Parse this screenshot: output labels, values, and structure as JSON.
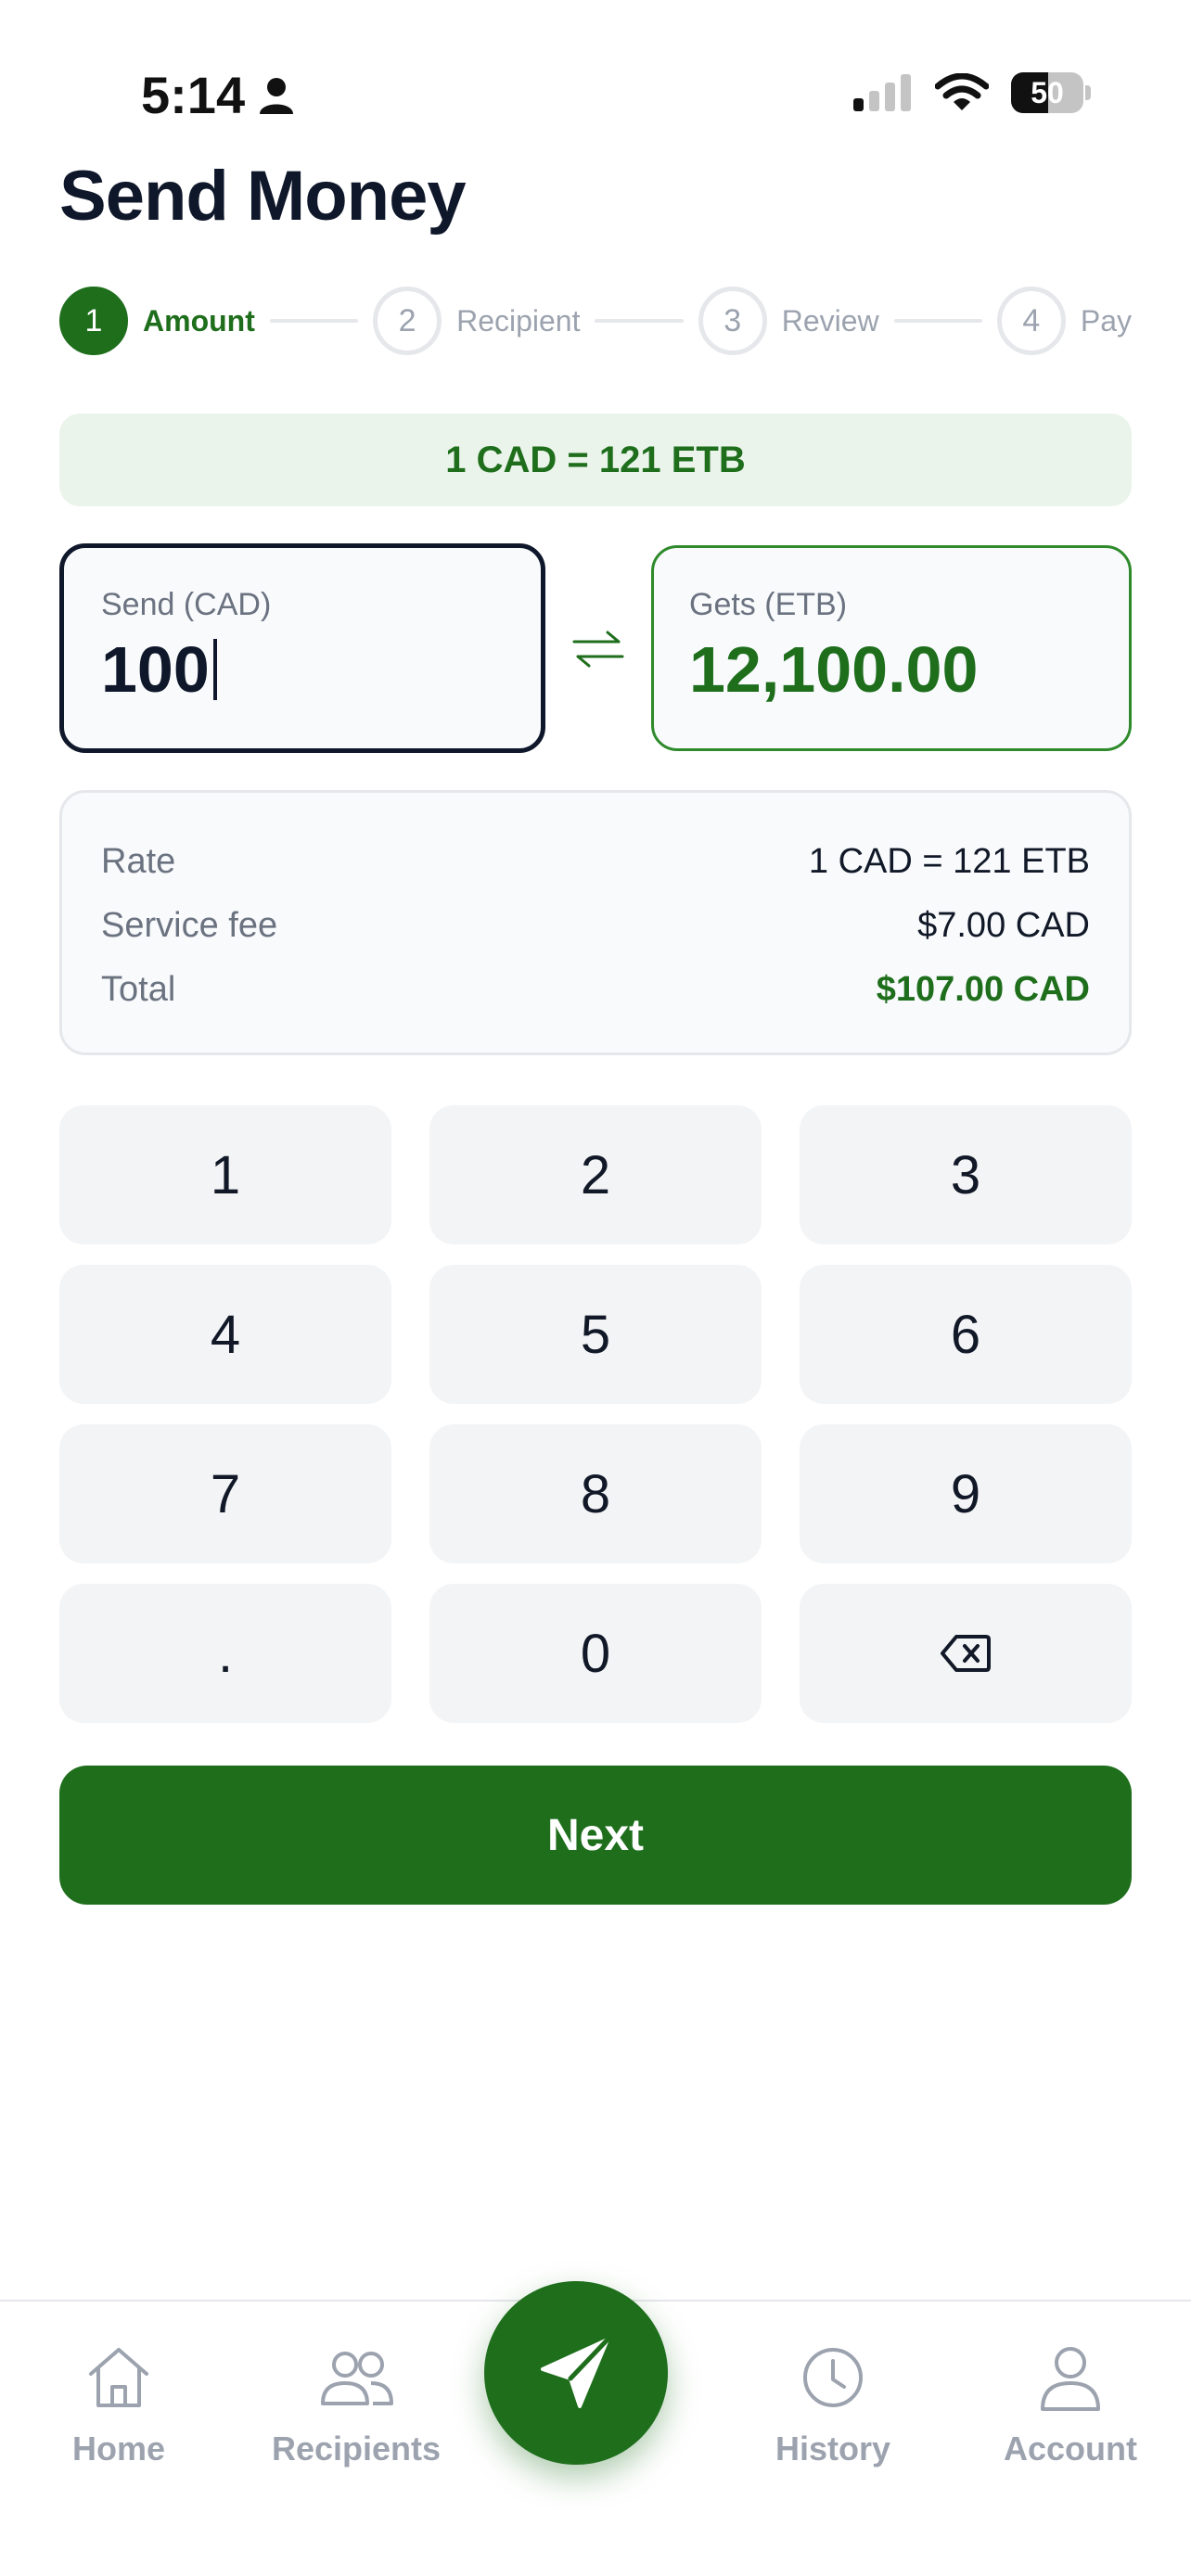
{
  "status": {
    "time": "5:14",
    "battery": "50"
  },
  "header": {
    "title": "Send Money"
  },
  "stepper": {
    "steps": [
      {
        "number": "1",
        "label": "Amount"
      },
      {
        "number": "2",
        "label": "Recipient"
      },
      {
        "number": "3",
        "label": "Review"
      },
      {
        "number": "4",
        "label": "Pay"
      }
    ],
    "active_index": 0
  },
  "rate_banner": {
    "text": "1 CAD = 121 ETB"
  },
  "send": {
    "label": "Send (CAD)",
    "value": "100"
  },
  "gets": {
    "label": "Gets (ETB)",
    "value": "12,100.00"
  },
  "summary": {
    "rows": [
      {
        "label": "Rate",
        "value": "1 CAD = 121 ETB"
      },
      {
        "label": "Service fee",
        "value": "$7.00 CAD"
      },
      {
        "label": "Total",
        "value": "$107.00 CAD"
      }
    ]
  },
  "keypad": {
    "keys": [
      "1",
      "2",
      "3",
      "4",
      "5",
      "6",
      "7",
      "8",
      "9",
      ".",
      "0"
    ],
    "backspace_icon": "backspace-icon"
  },
  "next_button": {
    "label": "Next"
  },
  "nav": {
    "items": [
      {
        "label": "Home",
        "icon": "home-icon"
      },
      {
        "label": "Recipients",
        "icon": "users-icon"
      },
      {
        "label": "History",
        "icon": "clock-icon"
      },
      {
        "label": "Account",
        "icon": "user-icon"
      }
    ],
    "fab_icon": "send-icon"
  },
  "colors": {
    "brand_green": "#1e6e1c",
    "banner_bg": "#eaf4ea",
    "text_dark": "#0f172a",
    "text_muted": "#6b7280",
    "key_bg": "#f3f4f6"
  }
}
